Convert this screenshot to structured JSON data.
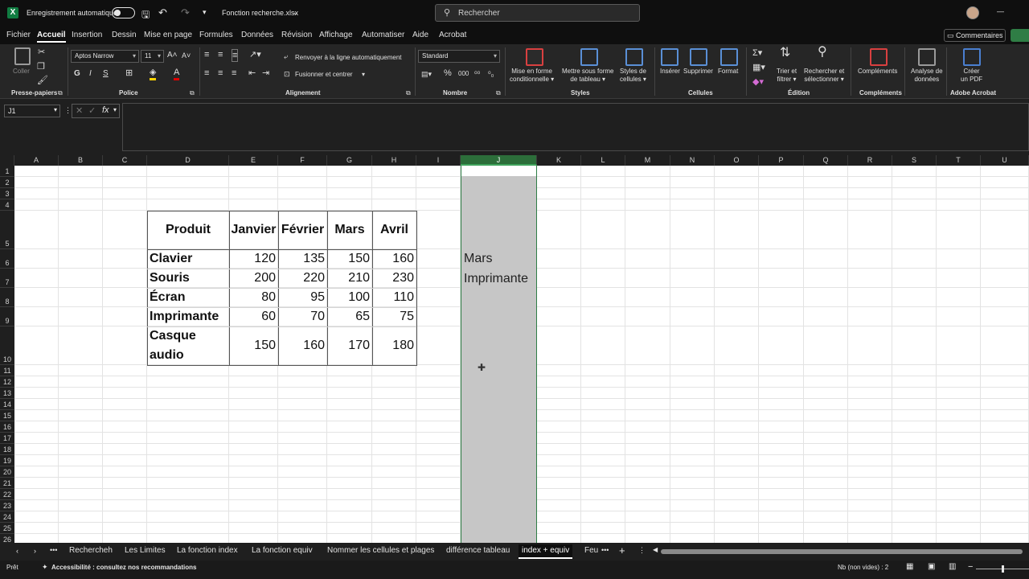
{
  "titlebar": {
    "autosave_label": "Enregistrement automatique",
    "filename": "Fonction recherche.xlsx",
    "search_placeholder": "Rechercher"
  },
  "tabs": [
    "Fichier",
    "Accueil",
    "Insertion",
    "Dessin",
    "Mise en page",
    "Formules",
    "Données",
    "Révision",
    "Affichage",
    "Automatiser",
    "Aide",
    "Acrobat"
  ],
  "comments_label": "Commentaires",
  "ribbon": {
    "clipboard": {
      "paste": "Coller",
      "group": "Presse-papiers"
    },
    "font": {
      "name": "Aptos Narrow",
      "size": "11",
      "bold": "G",
      "italic": "I",
      "underline": "S",
      "group": "Police"
    },
    "alignment": {
      "wrap": "Renvoyer à la ligne automatiquement",
      "merge": "Fusionner et centrer",
      "group": "Alignement"
    },
    "number": {
      "format": "Standard",
      "group": "Nombre"
    },
    "styles": {
      "conditional": [
        "Mise en forme",
        "conditionnelle"
      ],
      "table": [
        "Mettre sous forme",
        "de tableau"
      ],
      "cell_styles": [
        "Styles de",
        "cellules"
      ],
      "group": "Styles"
    },
    "cells": {
      "insert": "Insérer",
      "delete": "Supprimer",
      "format": "Format",
      "group": "Cellules"
    },
    "editing": {
      "sort": [
        "Trier et",
        "filtrer"
      ],
      "find": [
        "Rechercher et",
        "sélectionner"
      ],
      "group": "Édition"
    },
    "addins": {
      "label": "Compléments",
      "group": "Compléments"
    },
    "analyze": {
      "label": [
        "Analyse de",
        "données"
      ]
    },
    "acrobat": {
      "label": [
        "Créer",
        "un PDF"
      ],
      "group": "Adobe Acrobat"
    }
  },
  "formula_bar": {
    "name_box": "J1",
    "fx": "fx",
    "content": ""
  },
  "columns": [
    "A",
    "B",
    "C",
    "D",
    "E",
    "F",
    "G",
    "H",
    "I",
    "J",
    "K",
    "L",
    "M",
    "N",
    "O",
    "P",
    "Q",
    "R",
    "S",
    "T",
    "U"
  ],
  "selected_column": "J",
  "rows": [
    "1",
    "2",
    "3",
    "4",
    "5",
    "6",
    "7",
    "8",
    "9",
    "10",
    "11",
    "12",
    "13",
    "14",
    "15",
    "16",
    "17",
    "18",
    "19",
    "20",
    "21",
    "22",
    "23",
    "24",
    "25",
    "26"
  ],
  "table": {
    "headers": [
      "Produit",
      "Janvier",
      "Février",
      "Mars",
      "Avril"
    ],
    "rows": [
      {
        "product": "Clavier",
        "values": [
          "120",
          "135",
          "150",
          "160"
        ]
      },
      {
        "product": "Souris",
        "values": [
          "200",
          "220",
          "210",
          "230"
        ]
      },
      {
        "product": "Écran",
        "values": [
          "80",
          "95",
          "100",
          "110"
        ]
      },
      {
        "product": "Imprimante",
        "values": [
          "60",
          "70",
          "65",
          "75"
        ]
      },
      {
        "product": "Casque audio",
        "product_lines": [
          "Casque",
          "audio"
        ],
        "values": [
          "150",
          "160",
          "170",
          "180"
        ]
      }
    ]
  },
  "j_cells": {
    "J6": "Mars",
    "J7": "Imprimante"
  },
  "sheets": [
    "Rechercheh",
    "Les Limites",
    "La fonction index",
    "La fonction equiv",
    "Nommer les cellules et plages",
    "différence tableau",
    "index + equiv",
    "Feu"
  ],
  "active_sheet": "index + equiv",
  "status": {
    "ready": "Prêt",
    "accessibility": "Accessibilité : consultez nos recommandations",
    "count": "Nb (non vides) : 2"
  }
}
